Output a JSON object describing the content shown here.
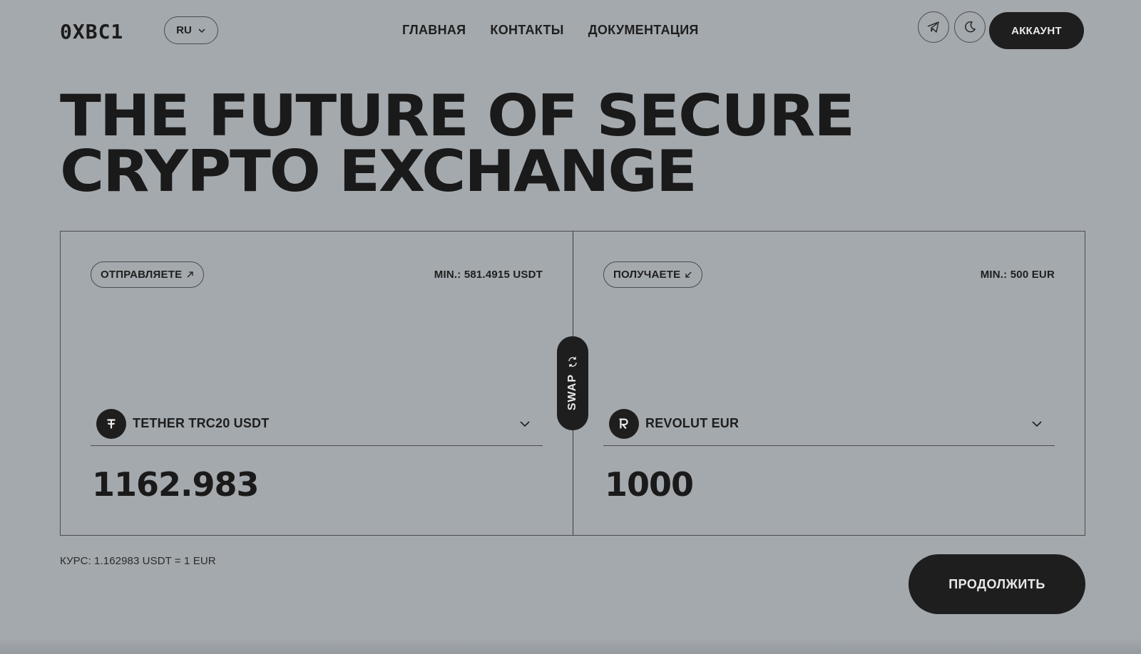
{
  "header": {
    "logo": "0XBC1",
    "language": "RU",
    "nav": [
      "ГЛАВНАЯ",
      "КОНТАКТЫ",
      "ДОКУМЕНТАЦИЯ"
    ],
    "account_label": "АККАУНТ"
  },
  "hero": {
    "line1": "THE FUTURE OF SECURE",
    "line2": "CRYPTO EXCHANGE"
  },
  "exchange": {
    "send": {
      "label": "ОТПРАВЛЯЕТЕ",
      "min": "MIN.: 581.4915 USDT",
      "asset": "TETHER TRC20 USDT",
      "asset_icon": "tether-icon",
      "amount": "1162.983"
    },
    "receive": {
      "label": "ПОЛУЧАЕТЕ",
      "min": "MIN.: 500 EUR",
      "asset": "REVOLUT EUR",
      "asset_icon": "revolut-icon",
      "amount": "1000"
    },
    "swap_label": "SWAP"
  },
  "footer": {
    "rate": "КУРС: 1.162983 USDT = 1 EUR",
    "continue_label": "ПРОДОЛЖИТЬ"
  },
  "colors": {
    "background": "#a4a9ad",
    "dark": "#1e1e1e",
    "border": "#4a4d50"
  }
}
